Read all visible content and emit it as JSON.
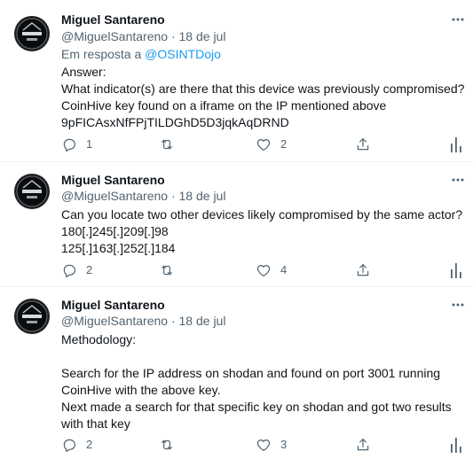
{
  "tweets": [
    {
      "author_name": "Miguel Santareno",
      "handle": "@MiguelSantareno",
      "separator": "·",
      "date": "18 de jul",
      "reply_prefix": "Em resposta a",
      "reply_mention": "@OSINTDojo",
      "lines": [
        "Answer:",
        "What indicator(s) are there that this device was previously compromised?",
        "CoinHive key found on a iframe on the IP mentioned above",
        "9pFICAsxNfFPjTILDGhD5D3jqkAqDRND"
      ],
      "actions": {
        "replies": "1",
        "retweets": "",
        "likes": "2"
      }
    },
    {
      "author_name": "Miguel Santareno",
      "handle": "@MiguelSantareno",
      "separator": "·",
      "date": "18 de jul",
      "lines": [
        "Can you locate two other devices likely compromised by the same actor?",
        "180[.]245[.]209[.]98",
        "125[.]163[.]252[.]184"
      ],
      "actions": {
        "replies": "2",
        "retweets": "",
        "likes": "4"
      }
    },
    {
      "author_name": "Miguel Santareno",
      "handle": "@MiguelSantareno",
      "separator": "·",
      "date": "18 de jul",
      "lines": [
        "Methodology:",
        "",
        "Search for the IP address on shodan and found on port 3001 running",
        "CoinHive with the above key.",
        "Next made a search for that specific key on shodan and got two results",
        "with that key"
      ],
      "actions": {
        "replies": "2",
        "retweets": "",
        "likes": "3"
      }
    }
  ],
  "colors": {
    "text": "#0f1419",
    "secondary": "#536471",
    "link": "#1d9bf0",
    "divider": "#eff3f4"
  },
  "icons": {
    "avatar": "round-logo-avatar",
    "more": "more-dots-icon",
    "reply": "reply-bubble-icon",
    "retweet": "retweet-icon",
    "like": "heart-icon",
    "share": "share-icon",
    "analytics": "analytics-icon"
  }
}
